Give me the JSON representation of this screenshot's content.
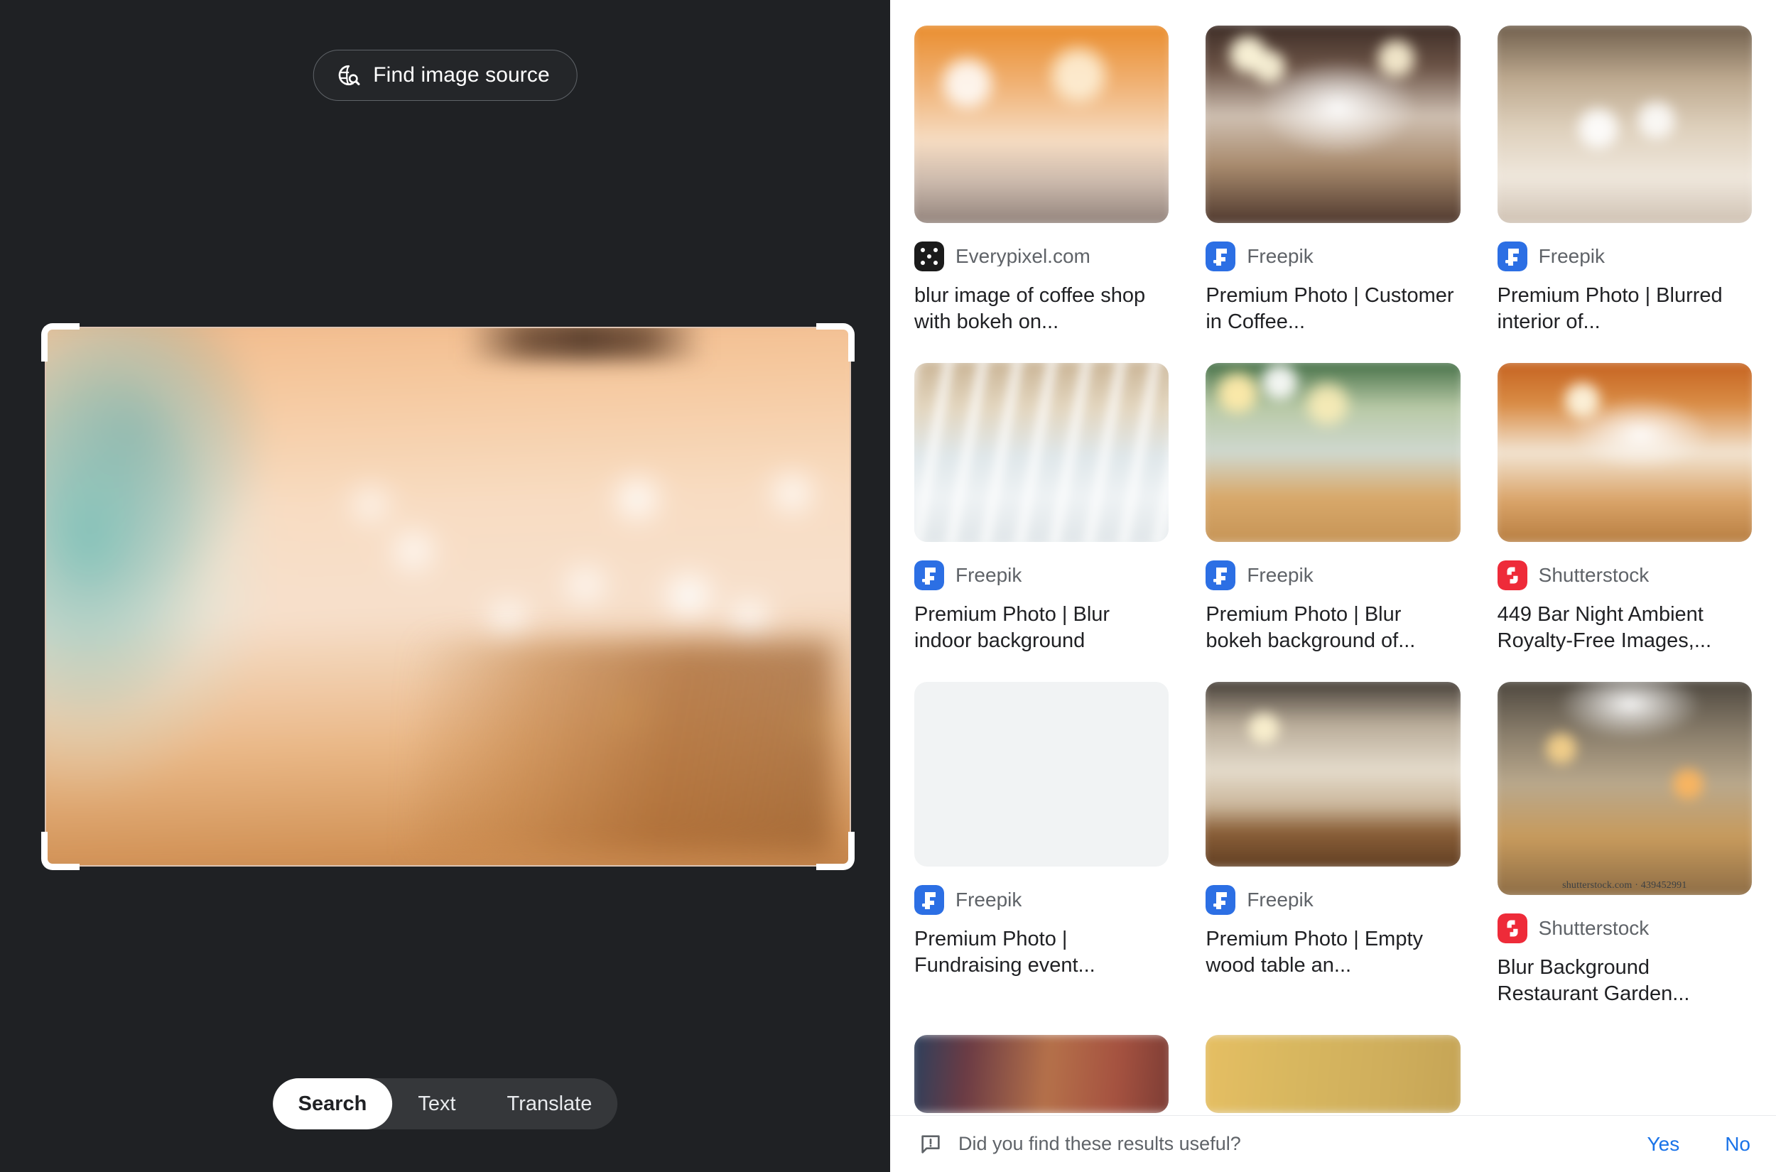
{
  "left_panel": {
    "find_source_button": {
      "label": "Find image source",
      "icon": "globe-search-icon"
    },
    "selection": {
      "icon_handles": "crop-corner-handle",
      "image_alt": "blurred cafe interior"
    },
    "modes": [
      {
        "id": "search",
        "label": "Search",
        "active": true
      },
      {
        "id": "text",
        "label": "Text",
        "active": false
      },
      {
        "id": "translate",
        "label": "Translate",
        "active": false
      }
    ]
  },
  "results": {
    "cards": [
      {
        "source": "Everypixel.com",
        "favicon": "everypixel-favicon",
        "favicon_color": "#1b1b1b",
        "title": "blur image of coffee shop with bokeh on...",
        "thumb_height": "h1",
        "watermark": ""
      },
      {
        "source": "Freepik",
        "favicon": "freepik-favicon",
        "favicon_color": "#2c6fe4",
        "title": "Premium Photo | Customer in Coffee...",
        "thumb_height": "h1",
        "watermark": ""
      },
      {
        "source": "Freepik",
        "favicon": "freepik-favicon",
        "favicon_color": "#2c6fe4",
        "title": "Premium Photo | Blurred interior of...",
        "thumb_height": "h1",
        "watermark": ""
      },
      {
        "source": "Freepik",
        "favicon": "freepik-favicon",
        "favicon_color": "#2c6fe4",
        "title": "Premium Photo | Blur indoor background",
        "thumb_height": "h2",
        "watermark": ""
      },
      {
        "source": "Freepik",
        "favicon": "freepik-favicon",
        "favicon_color": "#2c6fe4",
        "title": "Premium Photo | Blur bokeh background of...",
        "thumb_height": "h2",
        "watermark": ""
      },
      {
        "source": "Shutterstock",
        "favicon": "shutterstock-favicon",
        "favicon_color": "#ee2b39",
        "title": "449 Bar Night Ambient Royalty-Free Images,...",
        "thumb_height": "h2",
        "watermark": ""
      },
      {
        "source": "Freepik",
        "favicon": "freepik-favicon",
        "favicon_color": "#2c6fe4",
        "title": "Premium Photo | Fundraising event...",
        "thumb_height": "h3",
        "watermark": ""
      },
      {
        "source": "Freepik",
        "favicon": "freepik-favicon",
        "favicon_color": "#2c6fe4",
        "title": "Premium Photo | Empty wood table an...",
        "thumb_height": "h3",
        "watermark": ""
      },
      {
        "source": "Shutterstock",
        "favicon": "shutterstock-favicon",
        "favicon_color": "#ee2b39",
        "title": "Blur Background Restaurant Garden...",
        "thumb_height": "h3tall",
        "watermark": "shutterstock.com · 439452991"
      }
    ],
    "partial_row": [
      {
        "thumb_height": "h4"
      },
      {
        "thumb_height": "h4"
      }
    ]
  },
  "feedback": {
    "icon": "feedback-bubble-icon",
    "question": "Did you find these results useful?",
    "yes_label": "Yes",
    "no_label": "No",
    "link_color": "#1a73e8"
  }
}
